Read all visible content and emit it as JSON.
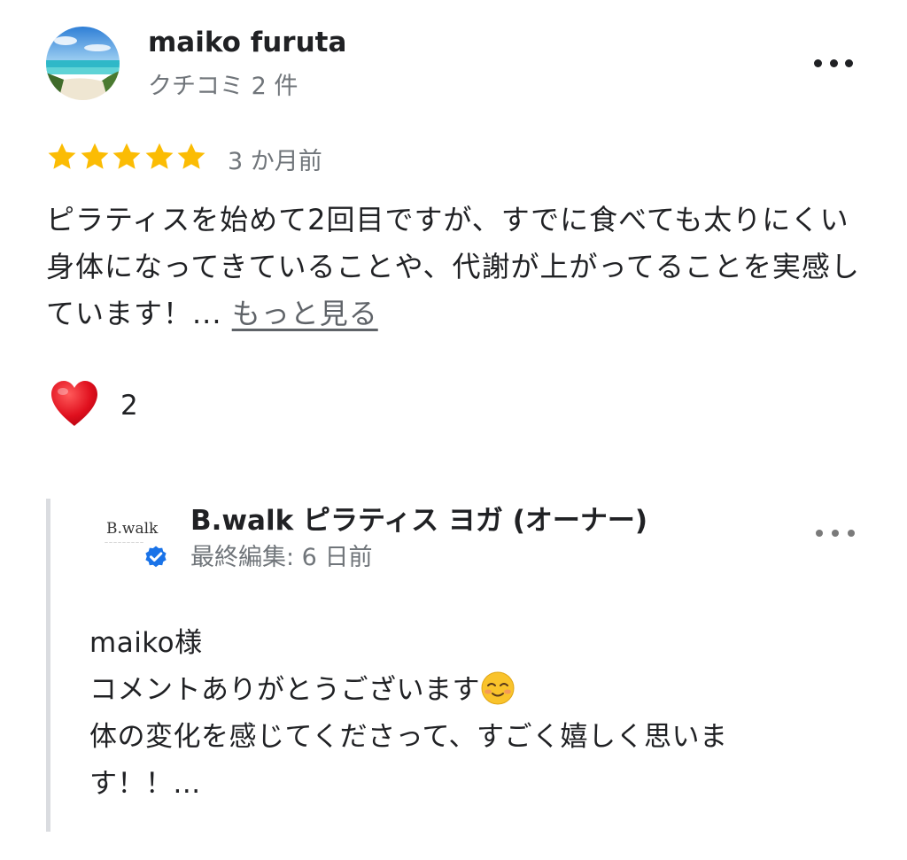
{
  "review": {
    "reviewer_name": "maiko furuta",
    "review_count": "クチコミ 2 件",
    "rating": 5,
    "time_ago": "3 か月前",
    "text": "ピラティスを始めて2回目ですが、すでに食べても太りにくい身体になってきていることや、代謝が上がってることを実感しています！...",
    "more_link": "もっと見る",
    "reactions": {
      "icon": "heart-icon",
      "count": "2"
    }
  },
  "owner_reply": {
    "logo_text": "B.walk",
    "owner_name": "B.walk ピラティス ヨガ (オーナー)",
    "edited": "最終編集: 6 日前",
    "lines": [
      "maiko様",
      "コメントありがとうございます",
      "体の変化を感じてくださって、すごく嬉しく思いま",
      "す！！..."
    ]
  },
  "colors": {
    "star": "#fbbc04",
    "verified": "#1a73e8",
    "heart": "#e0101e",
    "secondary_text": "#70757a"
  }
}
